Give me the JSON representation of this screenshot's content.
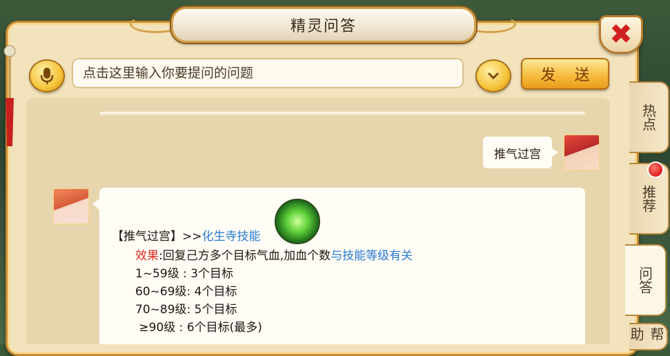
{
  "window": {
    "title": "精灵问答",
    "close_symbol": "✖"
  },
  "search": {
    "placeholder": "点击这里输入你要提问的问题",
    "send_label": "发 送"
  },
  "conversation": {
    "user_message": "推气过宫",
    "answer": {
      "title_prefix": "【推气过宫】>>",
      "title_link": "化生寺技能",
      "effect_label": "效果",
      "effect_text": ":回复己方多个目标气血,加血个数",
      "effect_link": "与技能等级有关",
      "levels": [
        "1~59级 : 3个目标",
        "60~69级: 4个目标",
        "70~89级: 5个目标",
        " ≥90级 : 6个目标(最多)"
      ]
    }
  },
  "side_tabs": [
    "热点",
    "推荐",
    "问答",
    "帮助"
  ],
  "colors": {
    "accent": "#f6b93a",
    "link": "#2a7ad1",
    "effect_label": "#e02a1e",
    "close": "#d21f1f"
  }
}
